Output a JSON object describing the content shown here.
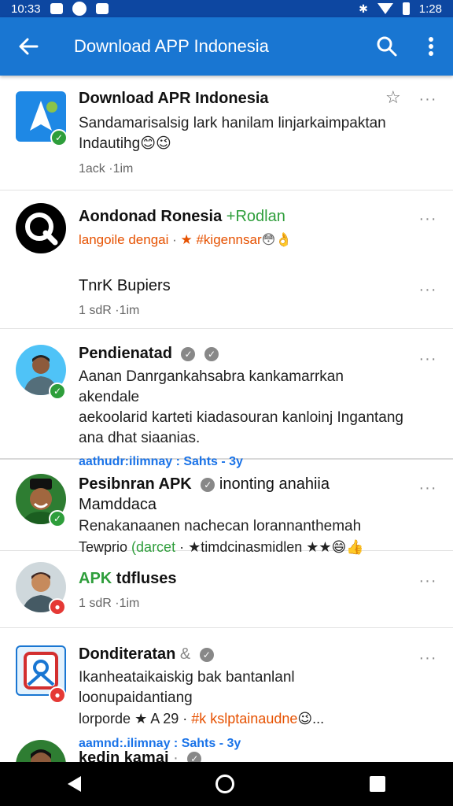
{
  "status_bar": {
    "time_left": "10:33",
    "time_right": "1:28"
  },
  "app_bar": {
    "title": "Download APP Indonesia",
    "icons": [
      "back-arrow-icon",
      "search-icon",
      "overflow-menu-icon"
    ]
  },
  "items": [
    {
      "title": "Download APR Indonesia",
      "body_line1": "Sandamarisalsig lark hanilam linjarkaimpaktan",
      "body_line2": "Indautihg",
      "body_line2_emoji": "😊😉",
      "meta": "1ack ·1im"
    },
    {
      "title": "Aondonad Ronesia",
      "title_green": "+Rodlan",
      "tag_orange": "langoile dengai",
      "tag_sep": " · ",
      "tag_rest": "★ #kigennsar",
      "tag_emoji": "😳👌"
    },
    {
      "title": "TnrK Bupiers",
      "meta": "1 sdR ·1im"
    },
    {
      "title": "Pendienatad",
      "body_line1": "Aanan Danrgankahsabra kankamarrkan akendale",
      "body_line2": "aekoolarid karteti kiadasouran kanloinj Ingantang",
      "body_line3": "ana dhat siaanias.",
      "link": "aathudr:ilimnay : Sahts - 3y"
    },
    {
      "title": "Pesibnran APK",
      "title_rest": "inonting anahiia Mamddaca",
      "body_line1": "Renakanaanen nachecan lorannanthemah",
      "tag_start": "Tewprio",
      "tag_green": "(darcet",
      "tag_rest": " · ★timdcinasmidlen ★★",
      "tag_emoji": "😄👍"
    },
    {
      "title_green": "APK",
      "title": "tdfluses",
      "meta": "1 sdR ·1im"
    },
    {
      "title": "Donditeratan",
      "title_mark": "&",
      "body_line1": "Ikanheataikaiskig bak bantanlanl loonupaidantiang",
      "tag_start": "lorporde",
      "tag_mid": "★ A 29 ·",
      "tag_orange": "#k kslptainaudne",
      "tag_emoji": "😉...",
      "link": "aamnd:.ilimnay : Sahts - 3y"
    },
    {
      "title": "kedin kamai",
      "title_rest": " ·"
    }
  ],
  "colors": {
    "status_bar": "#0d47a1",
    "app_bar": "#1976d2",
    "badge_green": "#2e9e3b",
    "badge_red": "#e53935",
    "link": "#1a73e8"
  }
}
